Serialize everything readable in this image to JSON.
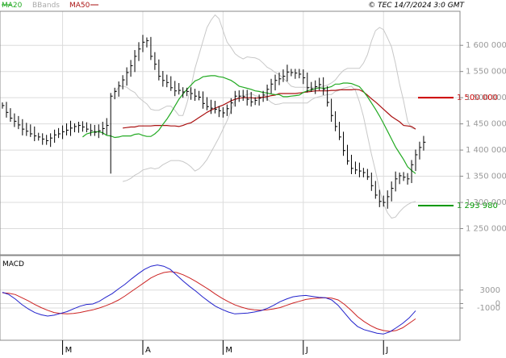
{
  "header": {
    "legend": [
      {
        "label": "MA20",
        "color": "#22aa22"
      },
      {
        "label": "BBands",
        "color": "#b0b0b0"
      },
      {
        "label": "MA50",
        "color": "#aa1111"
      }
    ],
    "source": "© TEC 14/7/2024 3:0 GMT"
  },
  "macd_label": "MACD",
  "colors": {
    "price": "#000000",
    "ma20": "#22aa22",
    "ma50": "#aa1111",
    "bb": "#c8c8c8",
    "grid": "#dcdcdc",
    "resistance": "#cc0000",
    "support": "#009900",
    "macd": "#2222cc",
    "signal": "#cc2222"
  },
  "chart_data": [
    {
      "type": "line",
      "title": "",
      "ylim": [
        1200000,
        1665000
      ],
      "y_ticks": [
        1250000,
        1300000,
        1350000,
        1400000,
        1450000,
        1500000,
        1550000,
        1600000
      ],
      "y_tick_labels": [
        "1 250 000",
        "1 300 000",
        "1 350 000",
        "1 400 000",
        "1 450 000",
        "1 500 000",
        "1 550 000",
        "1 600 000"
      ],
      "x_labels": [
        "M",
        "A",
        "M",
        "J",
        "J"
      ],
      "x_label_index": [
        15,
        35,
        55,
        75,
        95
      ],
      "n_sessions": 104,
      "levels": [
        {
          "name": "resistance",
          "value": 1500000,
          "label": "1 500 000",
          "color": "#cc0000"
        },
        {
          "name": "support",
          "value": 1293980,
          "label": "1 293 980",
          "color": "#009900"
        }
      ],
      "series": [
        {
          "id": "close",
          "values": [
            1485000,
            1472000,
            1461000,
            1455000,
            1448000,
            1440000,
            1436000,
            1431000,
            1427000,
            1425000,
            1421000,
            1418000,
            1423000,
            1429000,
            1431000,
            1435000,
            1438000,
            1442000,
            1445000,
            1447000,
            1444000,
            1440000,
            1437000,
            1434000,
            1437000,
            1441000,
            1447000,
            1503000,
            1512000,
            1523000,
            1534000,
            1548000,
            1561000,
            1579000,
            1593000,
            1606000,
            1609000,
            1579000,
            1564000,
            1541000,
            1533000,
            1529000,
            1519000,
            1513000,
            1514000,
            1511000,
            1512000,
            1508000,
            1503000,
            1501000,
            1489000,
            1483000,
            1480000,
            1478000,
            1475000,
            1471000,
            1479000,
            1490000,
            1503000,
            1503000,
            1502000,
            1497000,
            1492000,
            1495000,
            1499000,
            1505000,
            1516000,
            1526000,
            1533000,
            1536000,
            1541000,
            1549000,
            1548000,
            1547000,
            1545000,
            1538000,
            1519000,
            1517000,
            1521000,
            1525000,
            1516000,
            1491000,
            1466000,
            1445000,
            1425000,
            1399000,
            1379000,
            1365000,
            1362000,
            1360000,
            1357000,
            1349000,
            1332000,
            1314000,
            1302000,
            1300000,
            1311000,
            1327000,
            1345000,
            1351000,
            1348000,
            1345000,
            1372000,
            1391000,
            1405000,
            1415000
          ]
        },
        {
          "id": "ma20",
          "values": [
            1425000,
            1431000,
            1433000,
            1435000,
            1435000,
            1433000,
            1428000,
            1427000,
            1424000,
            1425000,
            1427000,
            1427000,
            1427000,
            1430000,
            1431000,
            1428000,
            1426000,
            1426000,
            1431000,
            1438000,
            1449000,
            1459000,
            1471000,
            1484000,
            1497000,
            1507000,
            1516000,
            1524000,
            1532000,
            1535000,
            1540000,
            1541000,
            1542000,
            1542000,
            1540000,
            1539000,
            1536000,
            1533000,
            1528000,
            1522000,
            1520000,
            1518000,
            1516000,
            1513000,
            1512000,
            1510000,
            1509000,
            1507000,
            1506000,
            1506000,
            1502000,
            1502000,
            1503000,
            1504000,
            1505000,
            1510000,
            1513000,
            1515000,
            1517000,
            1519000,
            1518000,
            1519000,
            1521000,
            1526000,
            1526000,
            1528000,
            1528000,
            1527000,
            1524000,
            1521000,
            1512000,
            1502000,
            1490000,
            1478000,
            1465000,
            1451000,
            1436000,
            1421000,
            1406000,
            1394000,
            1382000,
            1368000,
            1361000,
            1355000
          ]
        },
        {
          "id": "ma50",
          "values": [
            1442000,
            1443000,
            1444000,
            1444000,
            1446000,
            1446000,
            1446000,
            1446000,
            1447000,
            1447000,
            1447000,
            1447000,
            1446000,
            1446000,
            1445000,
            1447000,
            1450000,
            1452000,
            1457000,
            1462000,
            1467000,
            1472000,
            1476000,
            1480000,
            1483000,
            1486000,
            1490000,
            1494000,
            1497000,
            1499000,
            1500000,
            1500000,
            1500000,
            1499000,
            1500000,
            1501000,
            1502000,
            1504000,
            1505000,
            1508000,
            1508000,
            1508000,
            1508000,
            1508000,
            1509000,
            1510000,
            1511000,
            1512000,
            1513000,
            1513000,
            1513000,
            1513000,
            1514000,
            1514000,
            1515000,
            1515000,
            1515000,
            1515000,
            1516000,
            1515000,
            1511000,
            1505000,
            1498000,
            1492000,
            1485000,
            1478000,
            1471000,
            1464000,
            1459000,
            1454000,
            1447000,
            1446000,
            1445000,
            1440000
          ]
        },
        {
          "id": "bb_upper",
          "values": [
            1510000,
            1520000,
            1522000,
            1520000,
            1514000,
            1510000,
            1500000,
            1494000,
            1488000,
            1478000,
            1476000,
            1476000,
            1480000,
            1484000,
            1484000,
            1476000,
            1466000,
            1466000,
            1490000,
            1520000,
            1556000,
            1582000,
            1608000,
            1634000,
            1648000,
            1658000,
            1651000,
            1628000,
            1606000,
            1596000,
            1584000,
            1578000,
            1574000,
            1578000,
            1577000,
            1576000,
            1573000,
            1566000,
            1558000,
            1554000,
            1548000,
            1544000,
            1537000,
            1530000,
            1522000,
            1520000,
            1520000,
            1520000,
            1520000,
            1520000,
            1520000,
            1520000,
            1522000,
            1524000,
            1528000,
            1534000,
            1544000,
            1552000,
            1556000,
            1556000,
            1556000,
            1556000,
            1566000,
            1582000,
            1608000,
            1628000,
            1634000,
            1630000,
            1614000,
            1597000,
            1565000,
            1526000,
            1494000,
            1455000,
            1442000,
            1440000
          ]
        },
        {
          "id": "bb_lower",
          "values": [
            1340000,
            1342000,
            1346000,
            1352000,
            1356000,
            1362000,
            1364000,
            1366000,
            1364000,
            1366000,
            1372000,
            1376000,
            1380000,
            1380000,
            1380000,
            1378000,
            1374000,
            1368000,
            1360000,
            1364000,
            1372000,
            1382000,
            1396000,
            1410000,
            1424000,
            1440000,
            1456000,
            1476000,
            1494000,
            1502000,
            1504000,
            1506000,
            1508000,
            1504000,
            1502000,
            1500000,
            1498000,
            1491000,
            1487000,
            1488000,
            1490000,
            1490000,
            1490000,
            1490000,
            1490000,
            1490000,
            1490000,
            1496000,
            1500000,
            1502000,
            1504000,
            1506000,
            1506000,
            1512000,
            1514000,
            1518000,
            1520000,
            1522000,
            1514000,
            1492000,
            1464000,
            1428000,
            1392000,
            1360000,
            1324000,
            1298000,
            1280000,
            1270000,
            1272000,
            1282000,
            1290000,
            1296000,
            1300000,
            1302000
          ]
        }
      ]
    },
    {
      "type": "line",
      "title": "MACD",
      "ylim": [
        -8000,
        10500
      ],
      "y_ticks": [
        3000,
        0,
        -1000
      ],
      "y_tick_labels": [
        "3000",
        "0",
        "-1000"
      ],
      "series": [
        {
          "id": "macd",
          "values": [
            2500,
            2000,
            1000,
            -200,
            -1200,
            -2000,
            -2500,
            -2800,
            -2600,
            -2200,
            -1800,
            -1200,
            -600,
            -200,
            -100,
            500,
            1400,
            2200,
            3300,
            4300,
            5500,
            6600,
            7600,
            8300,
            8600,
            8300,
            7600,
            6300,
            5000,
            3800,
            2700,
            1500,
            400,
            -600,
            -1300,
            -1900,
            -2300,
            -2200,
            -2100,
            -1900,
            -1600,
            -1100,
            -400,
            400,
            1000,
            1500,
            1700,
            1800,
            1600,
            1400,
            1300,
            800,
            -400,
            -2100,
            -3800,
            -5100,
            -5800,
            -6200,
            -6600,
            -6800,
            -6300,
            -5400,
            -4400,
            -3200,
            -1600
          ]
        },
        {
          "id": "signal",
          "values": [
            2400,
            2300,
            2000,
            1300,
            600,
            -200,
            -900,
            -1500,
            -2000,
            -2200,
            -2300,
            -2200,
            -2000,
            -1700,
            -1400,
            -1000,
            -500,
            100,
            800,
            1700,
            2700,
            3700,
            4700,
            5700,
            6400,
            6900,
            7100,
            6900,
            6400,
            5700,
            4900,
            4000,
            3100,
            2100,
            1200,
            400,
            -300,
            -800,
            -1200,
            -1400,
            -1500,
            -1400,
            -1200,
            -900,
            -400,
            100,
            500,
            900,
            1100,
            1200,
            1300,
            1200,
            800,
            -200,
            -1500,
            -2900,
            -4000,
            -4900,
            -5600,
            -6000,
            -6200,
            -6000,
            -5400,
            -4400,
            -3400
          ]
        }
      ]
    }
  ]
}
